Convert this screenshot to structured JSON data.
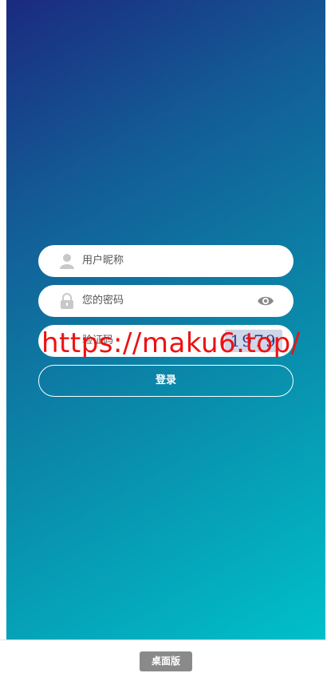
{
  "login": {
    "username_placeholder": "用户昵称",
    "password_placeholder": "您的密码",
    "captcha_placeholder": "验证码",
    "captcha_code": "1979",
    "submit_label": "登录"
  },
  "watermark": "https://maku6.top/",
  "footer": {
    "desktop_label": "桌面版"
  },
  "colors": {
    "gradient_start": "#1b2a7f",
    "gradient_end": "#00c0c9",
    "watermark": "#ee1111"
  },
  "icons": [
    "user-icon",
    "lock-icon",
    "eye-icon"
  ]
}
